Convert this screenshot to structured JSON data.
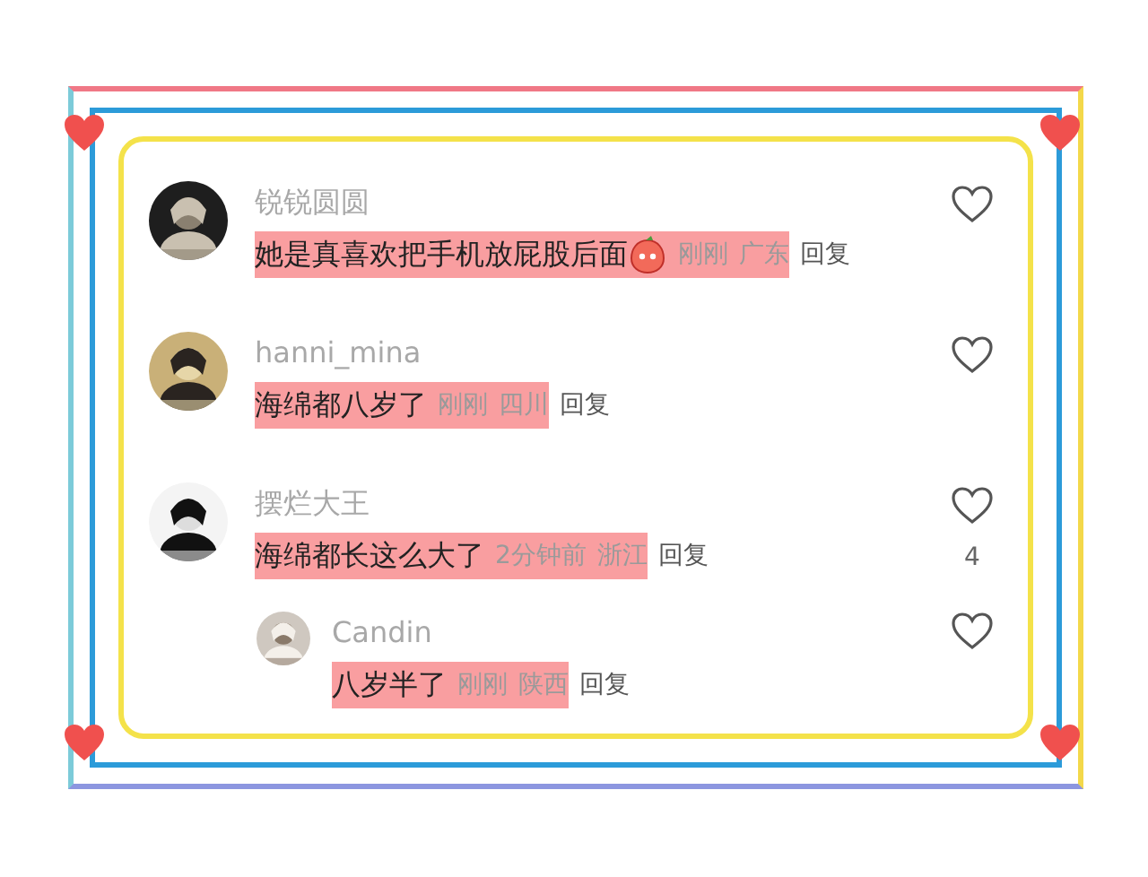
{
  "comments": [
    {
      "username": "锐锐圆圆",
      "text": "她是真喜欢把手机放屁股后面",
      "emoji": true,
      "time": "刚刚",
      "location": "广东",
      "reply": "回复",
      "highlighted": true
    },
    {
      "username": "hanni_mina",
      "text": "海绵都八岁了",
      "emoji": false,
      "time": "刚刚",
      "location": "四川",
      "reply": "回复",
      "highlighted": true
    },
    {
      "username": "摆烂大王",
      "text": "海绵都长这么大了",
      "emoji": false,
      "time": "2分钟前",
      "location": "浙江",
      "reply": "回复",
      "highlighted": true,
      "like_count": "4",
      "replies": [
        {
          "username": "Candin",
          "text": "八岁半了",
          "emoji": false,
          "time": "刚刚",
          "location": "陕西",
          "reply": "回复",
          "highlighted": true
        }
      ]
    }
  ]
}
